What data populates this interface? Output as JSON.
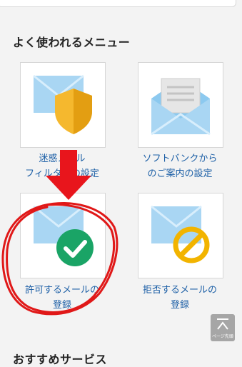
{
  "section_title": "よく使われるメニュー",
  "menu": [
    {
      "label": "迷惑メール\nフィルターの設定",
      "icon": "envelope-shield-icon"
    },
    {
      "label": "ソフトバンクから\nのご案内の設定",
      "icon": "open-envelope-letter-icon"
    },
    {
      "label": "許可するメールの\n登録",
      "icon": "envelope-check-icon"
    },
    {
      "label": "拒否するメールの\n登録",
      "icon": "envelope-prohibited-icon"
    }
  ],
  "next_section_title": "おすすめサービス",
  "page_top_label": "ページ先頭",
  "annotations": {
    "arrow_color": "#e8151c",
    "circle_color": "#e01818"
  },
  "colors": {
    "link": "#1c5fa6",
    "envelope": "#a9d6f3",
    "shield": "#f5b82e",
    "check": "#1aa466",
    "prohibit": "#f2b400"
  }
}
